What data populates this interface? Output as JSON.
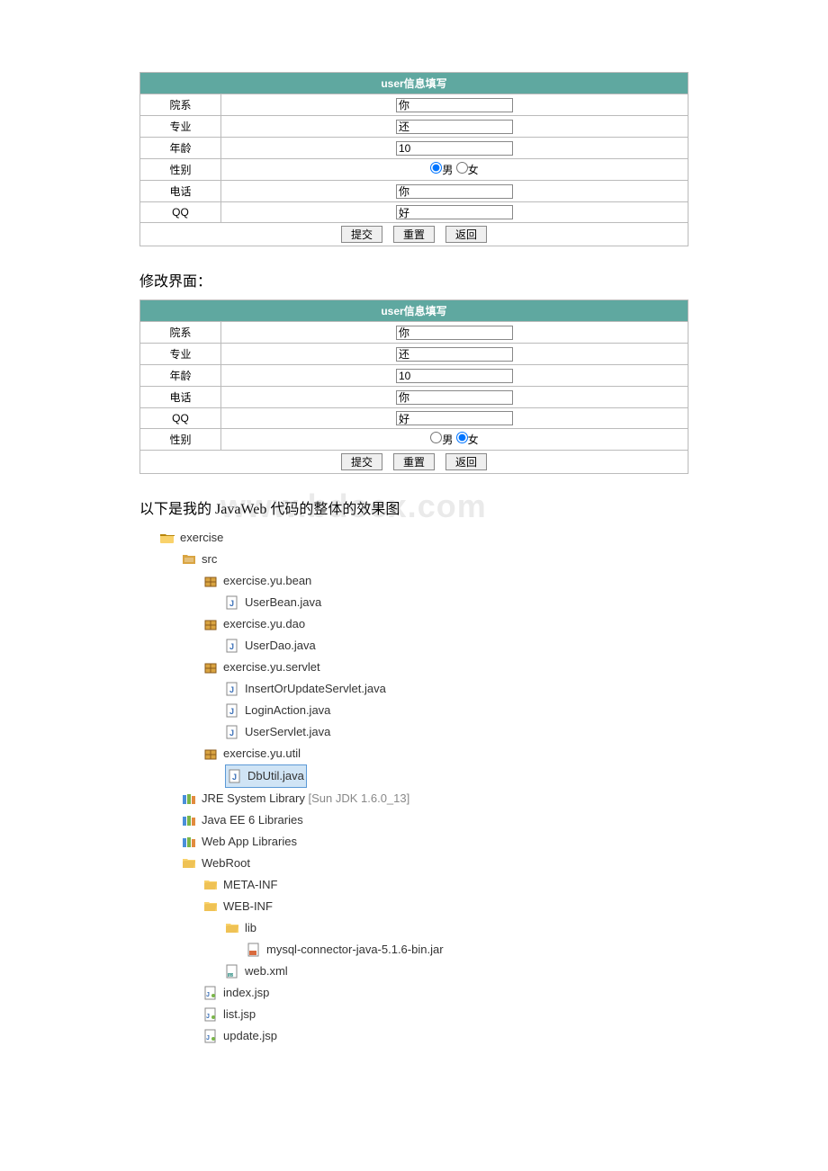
{
  "form1": {
    "title": "user信息填写",
    "rows": [
      {
        "label": "院系",
        "type": "text",
        "value": "你"
      },
      {
        "label": "专业",
        "type": "text",
        "value": "还"
      },
      {
        "label": "年龄",
        "type": "text",
        "value": "10"
      },
      {
        "label": "性别",
        "type": "radio",
        "options": [
          "男",
          "女"
        ],
        "selected": "男"
      },
      {
        "label": "电话",
        "type": "text",
        "value": "你"
      },
      {
        "label": "QQ",
        "type": "text",
        "value": "好"
      }
    ],
    "buttons": [
      "提交",
      "重置",
      "返回"
    ]
  },
  "heading_modify": "修改界面：",
  "form2": {
    "title": "user信息填写",
    "rows": [
      {
        "label": "院系",
        "type": "text",
        "value": "你"
      },
      {
        "label": "专业",
        "type": "text",
        "value": "还"
      },
      {
        "label": "年龄",
        "type": "text",
        "value": "10"
      },
      {
        "label": "电话",
        "type": "text",
        "value": "你"
      },
      {
        "label": "QQ",
        "type": "text",
        "value": "好"
      },
      {
        "label": "性别",
        "type": "radio",
        "options": [
          "男",
          "女"
        ],
        "selected": "女"
      }
    ],
    "buttons": [
      "提交",
      "重置",
      "返回"
    ]
  },
  "heading_code": "以下是我的 JavaWeb 代码的整体的效果图",
  "watermark": "www.bdocx.com",
  "tree": {
    "project": "exercise",
    "src": "src",
    "packages": [
      {
        "name": "exercise.yu.bean",
        "files": [
          "UserBean.java"
        ]
      },
      {
        "name": "exercise.yu.dao",
        "files": [
          "UserDao.java"
        ]
      },
      {
        "name": "exercise.yu.servlet",
        "files": [
          "InsertOrUpdateServlet.java",
          "LoginAction.java",
          "UserServlet.java"
        ]
      },
      {
        "name": "exercise.yu.util",
        "files": [
          "DbUtil.java"
        ]
      }
    ],
    "selected_file": "DbUtil.java",
    "libraries": [
      {
        "name": "JRE System Library",
        "extra": "[Sun JDK 1.6.0_13]"
      },
      {
        "name": "Java EE 6 Libraries",
        "extra": ""
      },
      {
        "name": "Web App Libraries",
        "extra": ""
      }
    ],
    "webroot": {
      "name": "WebRoot",
      "meta_inf": "META-INF",
      "web_inf": {
        "name": "WEB-INF",
        "lib": "lib",
        "lib_files": [
          "mysql-connector-java-5.1.6-bin.jar"
        ],
        "xml": "web.xml"
      },
      "jsps": [
        "index.jsp",
        "list.jsp",
        "update.jsp"
      ]
    }
  }
}
